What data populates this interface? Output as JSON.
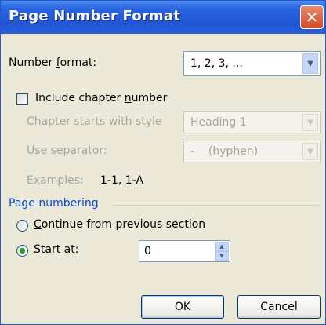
{
  "window": {
    "title": "Page Number Format",
    "close_glyph": "✕"
  },
  "number_format": {
    "label_pre": "Number ",
    "label_u": "f",
    "label_post": "ormat:",
    "value": "1, 2, 3, ..."
  },
  "include_chapter": {
    "label_pre": "Include chapter ",
    "label_u": "n",
    "label_post": "umber",
    "checked": false
  },
  "chapter_style": {
    "label": "Chapter starts with style",
    "value": "Heading 1"
  },
  "separator": {
    "label": "Use separator:",
    "value_dash": "-",
    "value_text": "(hyphen)"
  },
  "examples": {
    "label": "Examples:",
    "value": "1-1, 1-A"
  },
  "page_numbering": {
    "title": "Page numbering",
    "continue": {
      "label_u": "C",
      "label_post": "ontinue from previous section",
      "selected": false
    },
    "start_at": {
      "label_pre": "Start ",
      "label_u": "a",
      "label_post": "t:",
      "selected": true,
      "value": "0"
    }
  },
  "buttons": {
    "ok": "OK",
    "cancel": "Cancel"
  },
  "icons": {
    "dropdown": "chevron-down-icon",
    "spin_up": "spin-up-icon",
    "spin_down": "spin-down-icon"
  },
  "colors": {
    "titlebar": "#1f55d6",
    "group_title": "#0046d5",
    "radio_dot": "#21a121",
    "disabled_text": "#a8a697"
  }
}
